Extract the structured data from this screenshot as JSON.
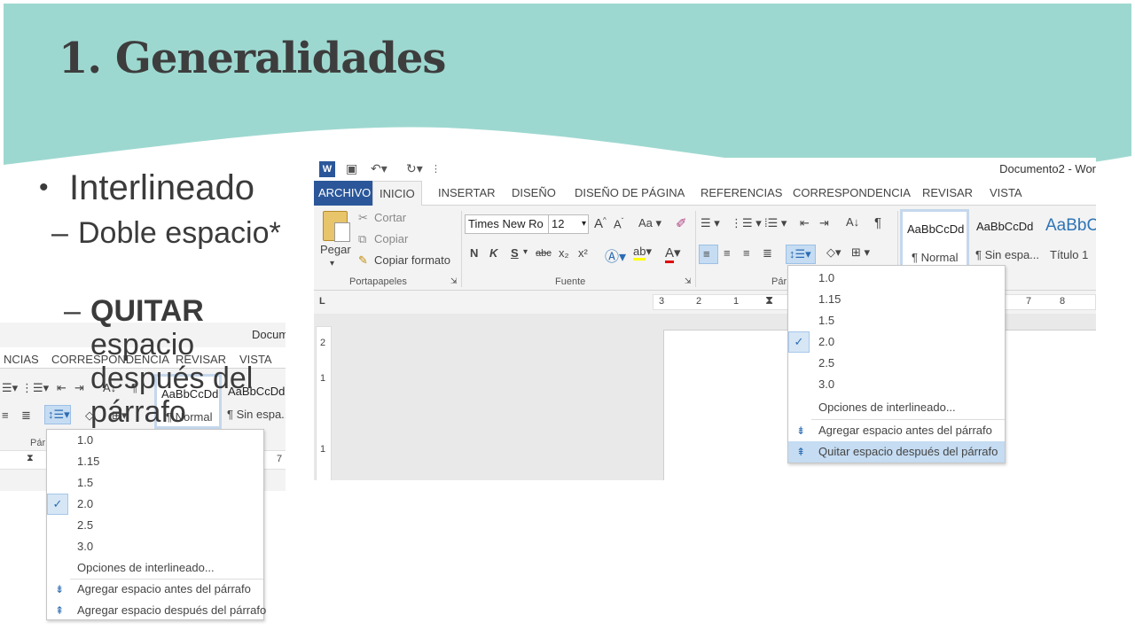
{
  "slide": {
    "title": "1. Generalidades",
    "bullet": "Interlineado",
    "sub1": "Doble espacio*",
    "sub2_bold": "QUITAR",
    "sub2_rest": " espacio después del párrafo",
    "bullet_marker": "•",
    "dash_marker": "–"
  },
  "colors": {
    "band": "#9dd8d0",
    "ribbon_blue": "#2b579a",
    "highlight": "#c5dcf2"
  },
  "word_large": {
    "doc_title": "Documento2 - Wor",
    "qat_icons": [
      "word-logo-icon",
      "save-icon",
      "undo-icon",
      "redo-icon",
      "customize-icon"
    ],
    "tabs": [
      "ARCHIVO",
      "INICIO",
      "INSERTAR",
      "DISEÑO",
      "DISEÑO DE PÁGINA",
      "REFERENCIAS",
      "CORRESPONDENCIA",
      "REVISAR",
      "VISTA"
    ],
    "clipboard": {
      "paste": "Pegar",
      "cut": "Cortar",
      "copy": "Copiar",
      "format_painter": "Copiar formato",
      "group_label": "Portapapeles"
    },
    "font": {
      "name": "Times New Ro",
      "size": "12",
      "grow": "A",
      "shrink": "A",
      "case": "Aa",
      "bold": "N",
      "italic": "K",
      "underline": "S",
      "strike": "abc",
      "sub": "x₂",
      "sup": "x²",
      "group_label": "Fuente"
    },
    "paragraph_label": "Pár",
    "styles": [
      {
        "preview": "AaBbCcDd",
        "name": "¶ Normal"
      },
      {
        "preview": "AaBbCcDd",
        "name": "¶ Sin espa..."
      },
      {
        "preview": "AaBbC",
        "name": "Título 1"
      }
    ],
    "ruler_left": [
      "3",
      "2",
      "1"
    ],
    "ruler_right": [
      "7",
      "8"
    ],
    "vruler": [
      "2",
      "1",
      "1"
    ],
    "tab_marker": "L",
    "menu": {
      "items": [
        "1.0",
        "1.15",
        "1.5",
        "2.0",
        "2.5",
        "3.0"
      ],
      "checked": "2.0",
      "options": "Opciones de interlineado...",
      "add_before": "Agregar espacio antes del párrafo",
      "remove_after": "Quitar espacio después del párrafo"
    }
  },
  "word_small": {
    "doc_title": "Docum",
    "tabs": [
      "NCIAS",
      "CORRESPONDENCIA",
      "REVISAR",
      "VISTA"
    ],
    "styles": [
      {
        "preview": "AaBbCcDd",
        "name": "¶ Normal"
      },
      {
        "preview": "AaBbCcDd",
        "name": "¶ Sin espa..."
      }
    ],
    "paragraph_label": "Pár",
    "ruler_right": "7",
    "menu": {
      "items": [
        "1.0",
        "1.15",
        "1.5",
        "2.0",
        "2.5",
        "3.0"
      ],
      "checked": "2.0",
      "options": "Opciones de interlineado...",
      "add_before": "Agregar espacio antes del párrafo",
      "add_after": "Agregar espacio después del párrafo"
    }
  }
}
